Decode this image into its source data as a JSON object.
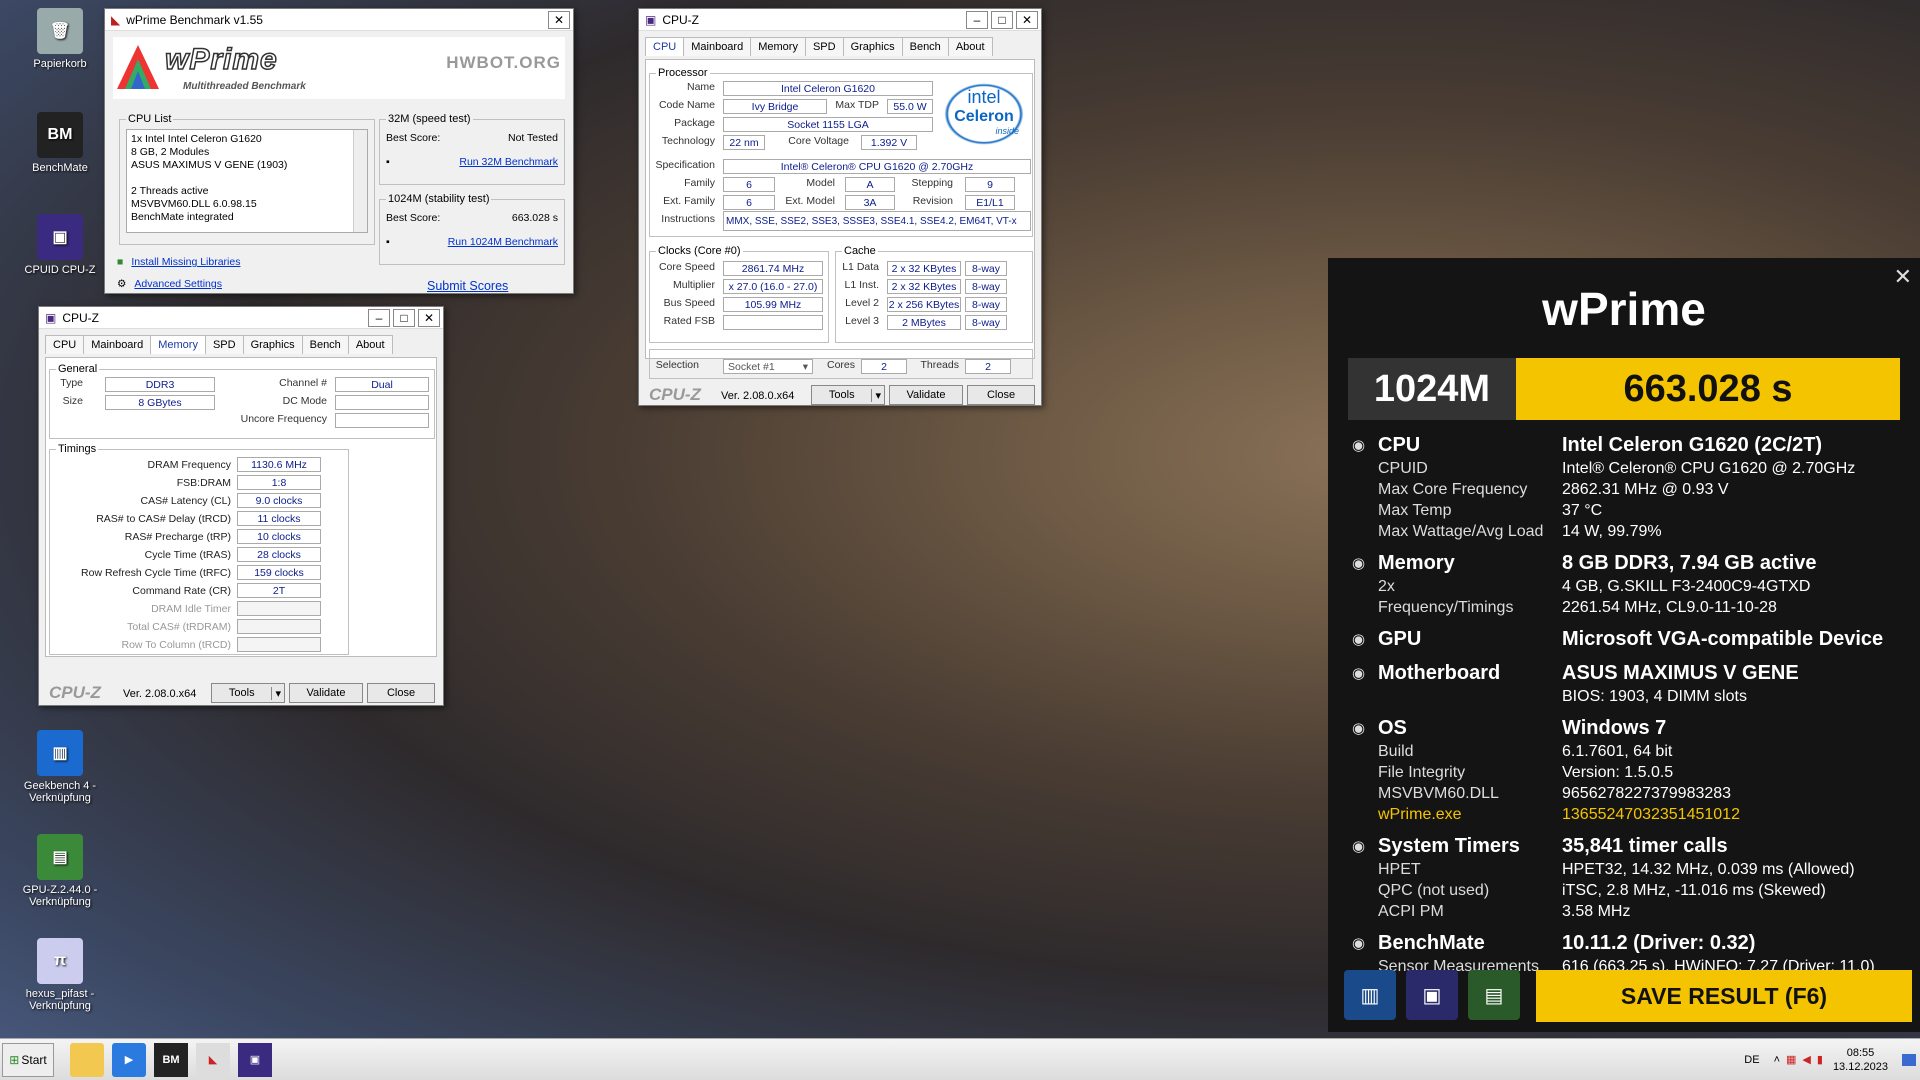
{
  "desktop": {
    "icons": [
      {
        "label": "Papierkorb",
        "icon": "recycle-bin-icon"
      },
      {
        "label": "BenchMate",
        "icon": "benchmate-icon"
      },
      {
        "label": "CPUID CPU-Z",
        "icon": "cpuz-icon"
      },
      {
        "label": "Geekbench 4 -\nVerknüpfung",
        "icon": "geekbench-icon"
      },
      {
        "label": "GPU-Z.2.44.0 -\nVerknüpfung",
        "icon": "gpuz-icon"
      },
      {
        "label": "hexus_pifast -\nVerknüpfung",
        "icon": "pifast-icon"
      }
    ]
  },
  "wprime": {
    "title": "wPrime Benchmark v1.55",
    "logo": "wPrime",
    "subtitle": "Multithreaded Benchmark",
    "hwbot": "HWBOT.ORG",
    "cpulist_legend": "CPU List",
    "cpulist": [
      "1x Intel Intel Celeron G1620",
      "8 GB, 2 Modules",
      "ASUS MAXIMUS V GENE (1903)",
      "",
      "2 Threads active",
      "MSVBVM60.DLL 6.0.98.15",
      "BenchMate integrated"
    ],
    "s32_legend": "32M (speed test)",
    "s32_label": "Best Score:",
    "s32_val": "Not Tested",
    "s32_run": "Run 32M Benchmark",
    "s1024_legend": "1024M (stability test)",
    "s1024_label": "Best Score:",
    "s1024_val": "663.028 s",
    "s1024_run": "Run 1024M Benchmark",
    "install": "Install Missing Libraries",
    "advanced": "Advanced Settings",
    "submit": "Submit Scores"
  },
  "cpuz_cpu": {
    "title": "CPU-Z",
    "tabs": [
      "CPU",
      "Mainboard",
      "Memory",
      "SPD",
      "Graphics",
      "Bench",
      "About"
    ],
    "processor_legend": "Processor",
    "name_l": "Name",
    "name": "Intel Celeron G1620",
    "codename_l": "Code Name",
    "codename": "Ivy Bridge",
    "tdp_l": "Max TDP",
    "tdp": "55.0 W",
    "package_l": "Package",
    "package": "Socket 1155 LGA",
    "tech_l": "Technology",
    "tech": "22 nm",
    "voltage_l": "Core Voltage",
    "voltage": "1.392 V",
    "spec_l": "Specification",
    "spec": "Intel® Celeron® CPU G1620 @ 2.70GHz",
    "family_l": "Family",
    "family": "6",
    "model_l": "Model",
    "model": "A",
    "stepping_l": "Stepping",
    "stepping": "9",
    "extfam_l": "Ext. Family",
    "extfam": "6",
    "extmodel_l": "Ext. Model",
    "extmodel": "3A",
    "revision_l": "Revision",
    "revision": "E1/L1",
    "instr_l": "Instructions",
    "instr": "MMX, SSE, SSE2, SSE3, SSSE3, SSE4.1, SSE4.2, EM64T, VT-x",
    "intel_logo": "intel",
    "celeron_logo": "Celeron",
    "inside": "inside",
    "clocks_legend": "Clocks (Core #0)",
    "corespeed_l": "Core Speed",
    "corespeed": "2861.74 MHz",
    "mult_l": "Multiplier",
    "mult": "x 27.0 (16.0 - 27.0)",
    "bus_l": "Bus Speed",
    "bus": "105.99 MHz",
    "fsb_l": "Rated FSB",
    "fsb": "",
    "cache_legend": "Cache",
    "l1d_l": "L1 Data",
    "l1d": "2 x 32 KBytes",
    "l1d_w": "8-way",
    "l1i_l": "L1 Inst.",
    "l1i": "2 x 32 KBytes",
    "l1i_w": "8-way",
    "l2_l": "Level 2",
    "l2": "2 x 256 KBytes",
    "l2_w": "8-way",
    "l3_l": "Level 3",
    "l3": "2 MBytes",
    "l3_w": "8-way",
    "selection_l": "Selection",
    "selection": "Socket #1",
    "cores_l": "Cores",
    "cores": "2",
    "threads_l": "Threads",
    "threads": "2",
    "brand": "CPU-Z",
    "version": "Ver. 2.08.0.x64",
    "tools": "Tools",
    "validate": "Validate",
    "close": "Close"
  },
  "cpuz_mem": {
    "title": "CPU-Z",
    "tabs": [
      "CPU",
      "Mainboard",
      "Memory",
      "SPD",
      "Graphics",
      "Bench",
      "About"
    ],
    "general_legend": "General",
    "type_l": "Type",
    "type": "DDR3",
    "channel_l": "Channel #",
    "channel": "Dual",
    "size_l": "Size",
    "size": "8 GBytes",
    "dcmode_l": "DC Mode",
    "uncore_l": "Uncore Frequency",
    "timings_legend": "Timings",
    "timings": [
      {
        "l": "DRAM Frequency",
        "v": "1130.6 MHz"
      },
      {
        "l": "FSB:DRAM",
        "v": "1:8"
      },
      {
        "l": "CAS# Latency (CL)",
        "v": "9.0 clocks"
      },
      {
        "l": "RAS# to CAS# Delay (tRCD)",
        "v": "11 clocks"
      },
      {
        "l": "RAS# Precharge (tRP)",
        "v": "10 clocks"
      },
      {
        "l": "Cycle Time (tRAS)",
        "v": "28 clocks"
      },
      {
        "l": "Row Refresh Cycle Time (tRFC)",
        "v": "159 clocks"
      },
      {
        "l": "Command Rate (CR)",
        "v": "2T"
      },
      {
        "l": "DRAM Idle Timer",
        "v": ""
      },
      {
        "l": "Total CAS# (tRDRAM)",
        "v": ""
      },
      {
        "l": "Row To Column (tRCD)",
        "v": ""
      }
    ],
    "brand": "CPU-Z",
    "version": "Ver. 2.08.0.x64",
    "tools": "Tools",
    "validate": "Validate",
    "close": "Close"
  },
  "benchmate": {
    "title": "wPrime",
    "mode": "1024M",
    "score": "663.028 s",
    "sections": [
      {
        "icon": "cpu-icon",
        "h": "CPU",
        "hv": "Intel Celeron G1620 (2C/2T)",
        "rows": [
          [
            "CPUID",
            "Intel® Celeron® CPU G1620 @ 2.70GHz"
          ],
          [
            "Max Core Frequency",
            "2862.31 MHz @ 0.93 V"
          ],
          [
            "Max Temp",
            "37 °C"
          ],
          [
            "Max Wattage/Avg Load",
            "14 W, 99.79%"
          ]
        ]
      },
      {
        "icon": "memory-icon",
        "h": "Memory",
        "hv": "8 GB DDR3, 7.94 GB active",
        "rows": [
          [
            "2x",
            "4 GB, G.SKILL F3-2400C9-4GTXD"
          ],
          [
            "Frequency/Timings",
            "2261.54 MHz, CL9.0-11-10-28"
          ]
        ]
      },
      {
        "icon": "gpu-icon",
        "h": "GPU",
        "hv": "Microsoft VGA-compatible Device",
        "rows": []
      },
      {
        "icon": "motherboard-icon",
        "h": "Motherboard",
        "hv": "ASUS MAXIMUS V GENE",
        "rows": [
          [
            "",
            "BIOS: 1903, 4 DIMM slots"
          ]
        ]
      },
      {
        "icon": "windows-icon",
        "h": "OS",
        "hv": "Windows 7",
        "rows": [
          [
            "Build",
            "6.1.7601, 64 bit"
          ],
          [
            "File Integrity",
            "Version: 1.5.0.5"
          ],
          [
            "MSVBVM60.DLL",
            "9656278227379983283"
          ],
          [
            "wPrime.exe",
            "13655247032351451012"
          ]
        ]
      },
      {
        "icon": "timer-icon",
        "h": "System Timers",
        "hv": "35,841 timer calls",
        "rows": [
          [
            "HPET",
            "HPET32, 14.32 MHz, 0.039 ms (Allowed)"
          ],
          [
            "QPC (not used)",
            "iTSC, 2.8 MHz, -11.016 ms (Skewed)"
          ],
          [
            "ACPI PM",
            "3.58 MHz"
          ]
        ]
      },
      {
        "icon": "benchmate-icon",
        "h": "BenchMate",
        "hv": "10.11.2 (Driver: 0.32)",
        "rows": [
          [
            "Sensor Measurements",
            "616 (663.25 s), HWiNFO: 7.27 (Driver: 11.0)"
          ]
        ]
      }
    ],
    "save": "SAVE RESULT (F6)",
    "accent": "#f5c400"
  },
  "taskbar": {
    "start": "Start",
    "lang": "DE",
    "time": "08:55",
    "date": "13.12.2023"
  }
}
